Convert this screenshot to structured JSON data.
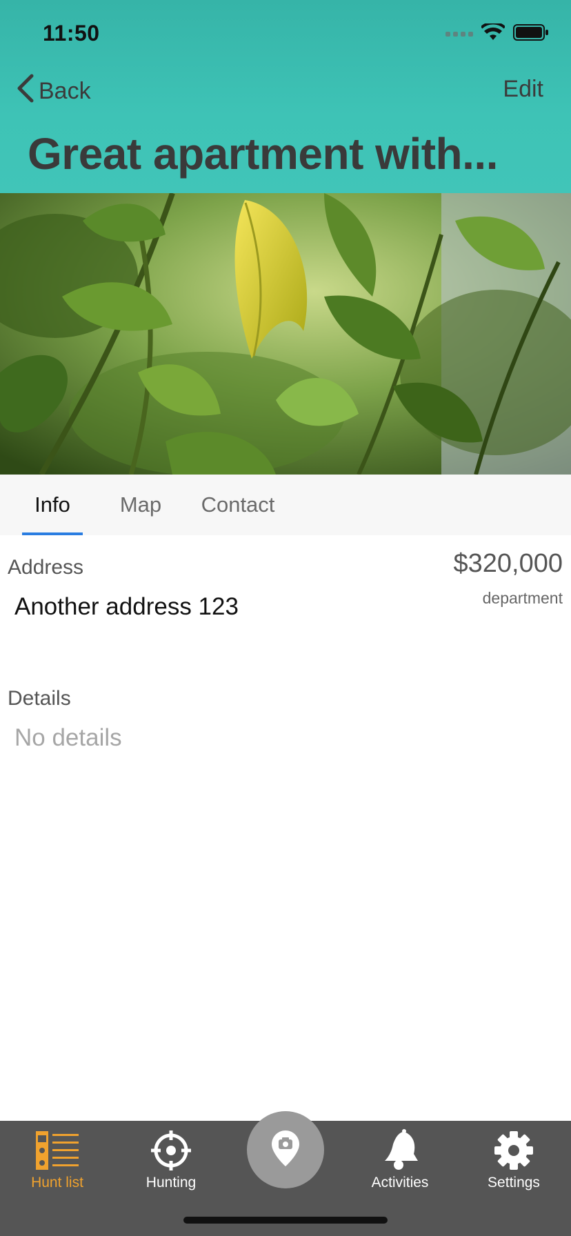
{
  "status_bar": {
    "time": "11:50"
  },
  "nav": {
    "back_label": "Back",
    "edit_label": "Edit",
    "title": "Great apartment with..."
  },
  "photo": {
    "description_icon": "leaves-photo"
  },
  "tabs": [
    {
      "label": "Info",
      "active": true
    },
    {
      "label": "Map",
      "active": false
    },
    {
      "label": "Contact",
      "active": false
    }
  ],
  "info": {
    "address_label": "Address",
    "address_value": "Another address 123",
    "price": "$320,000",
    "property_type": "department",
    "details_label": "Details",
    "details_value": "No details"
  },
  "tabbar": {
    "items": [
      {
        "label": "Hunt list",
        "icon": "hunt-list-icon",
        "active": true
      },
      {
        "label": "Hunting",
        "icon": "crosshair-icon",
        "active": false
      },
      {
        "label": "",
        "icon": "camera-pin-icon",
        "active": false
      },
      {
        "label": "Activities",
        "icon": "bell-icon",
        "active": false
      },
      {
        "label": "Settings",
        "icon": "gear-icon",
        "active": false
      }
    ]
  },
  "colors": {
    "header": "#3ec3b6",
    "tab_underline": "#2a7de1",
    "tabbar_bg": "#555555",
    "active_tab": "#f0a22e"
  }
}
